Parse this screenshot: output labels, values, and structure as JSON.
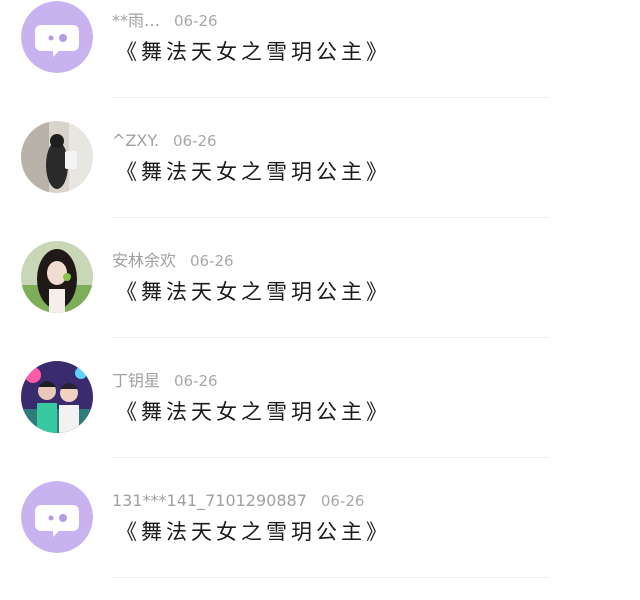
{
  "colors": {
    "default_avatar_bg": "#c8b2ef",
    "bubble_eyes": "#b59ae6"
  },
  "comments": [
    {
      "avatar_icon": "default-chat-bubble-avatar",
      "username": "**雨…",
      "date": "06-26",
      "text": "《舞法天女之雪玥公主》"
    },
    {
      "avatar_icon": "user-photo-avatar",
      "username": "^ZXY.",
      "date": "06-26",
      "text": "《舞法天女之雪玥公主》"
    },
    {
      "avatar_icon": "user-photo-avatar",
      "username": "安林余欢",
      "date": "06-26",
      "text": "《舞法天女之雪玥公主》"
    },
    {
      "avatar_icon": "user-photo-avatar",
      "username": "丁钥星",
      "date": "06-26",
      "text": "《舞法天女之雪玥公主》"
    },
    {
      "avatar_icon": "default-chat-bubble-avatar",
      "username": "131***141_7101290887",
      "date": "06-26",
      "text": "《舞法天女之雪玥公主》"
    }
  ]
}
